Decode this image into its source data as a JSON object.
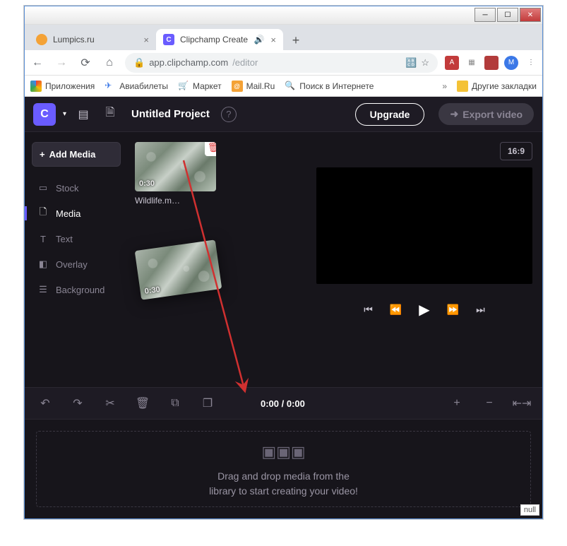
{
  "window": {
    "tabs": [
      {
        "label": "Lumpics.ru",
        "favicon_color": "#f4a236"
      },
      {
        "label": "Clipchamp Create",
        "favicon_color": "#6a5cff",
        "audio": true
      }
    ]
  },
  "browser": {
    "url_host": "app.clipchamp.com",
    "url_path": "/editor",
    "bookmarks_app_label": "Приложения",
    "bookmarks": [
      {
        "label": "Авиабилеты",
        "color": "#3b78e7"
      },
      {
        "label": "Маркет",
        "color": "#f4c236"
      },
      {
        "label": "Mail.Ru",
        "color": "#f4a236"
      },
      {
        "label": "Поиск в Интернете",
        "color": "#f4a236"
      }
    ],
    "other_bookmarks": "Другие закладки"
  },
  "app": {
    "logo_letter": "C",
    "project_title": "Untitled Project",
    "upgrade_label": "Upgrade",
    "export_label": "Export video",
    "sidebar": {
      "add_media": "Add Media",
      "items": [
        {
          "label": "Stock"
        },
        {
          "label": "Media"
        },
        {
          "label": "Text"
        },
        {
          "label": "Overlay"
        },
        {
          "label": "Background"
        }
      ],
      "active_index": 1
    },
    "media": {
      "clips": [
        {
          "name": "Wildlife.m…",
          "duration": "0:30"
        }
      ]
    },
    "dragging_clip": {
      "duration": "0:30"
    },
    "preview": {
      "ratio": "16:9"
    },
    "timeline": {
      "time_display": "0:00 / 0:00",
      "dropzone_line1": "Drag and drop media from the",
      "dropzone_line2": "library to start creating your video!"
    },
    "null_badge": "null"
  }
}
